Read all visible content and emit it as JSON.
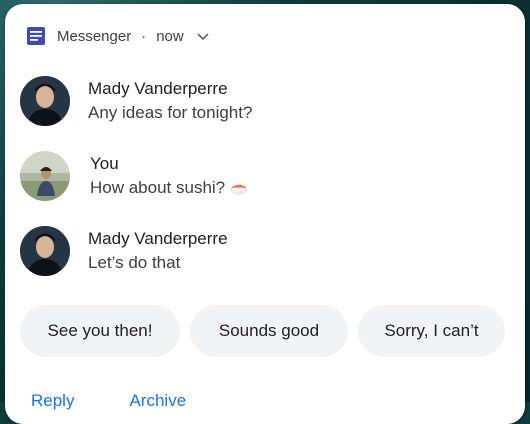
{
  "notification": {
    "app_name": "Messenger",
    "separator": "·",
    "time": "now",
    "messages": [
      {
        "sender": "Mady Vanderperre",
        "text": "Any ideas for tonight?"
      },
      {
        "sender": "You",
        "text": "How about sushi?",
        "emoji": "sushi-icon"
      },
      {
        "sender": "Mady Vanderperre",
        "text": "Let’s do that"
      }
    ],
    "smart_replies": [
      "See you then!",
      "Sounds good",
      "Sorry, I can’t"
    ],
    "actions": [
      "Reply",
      "Archive"
    ]
  },
  "colors": {
    "accent": "#1a73e8",
    "app_icon": "#3c4bb5",
    "chip_bg": "#f1f3f4",
    "background": "#0e3a3c"
  }
}
